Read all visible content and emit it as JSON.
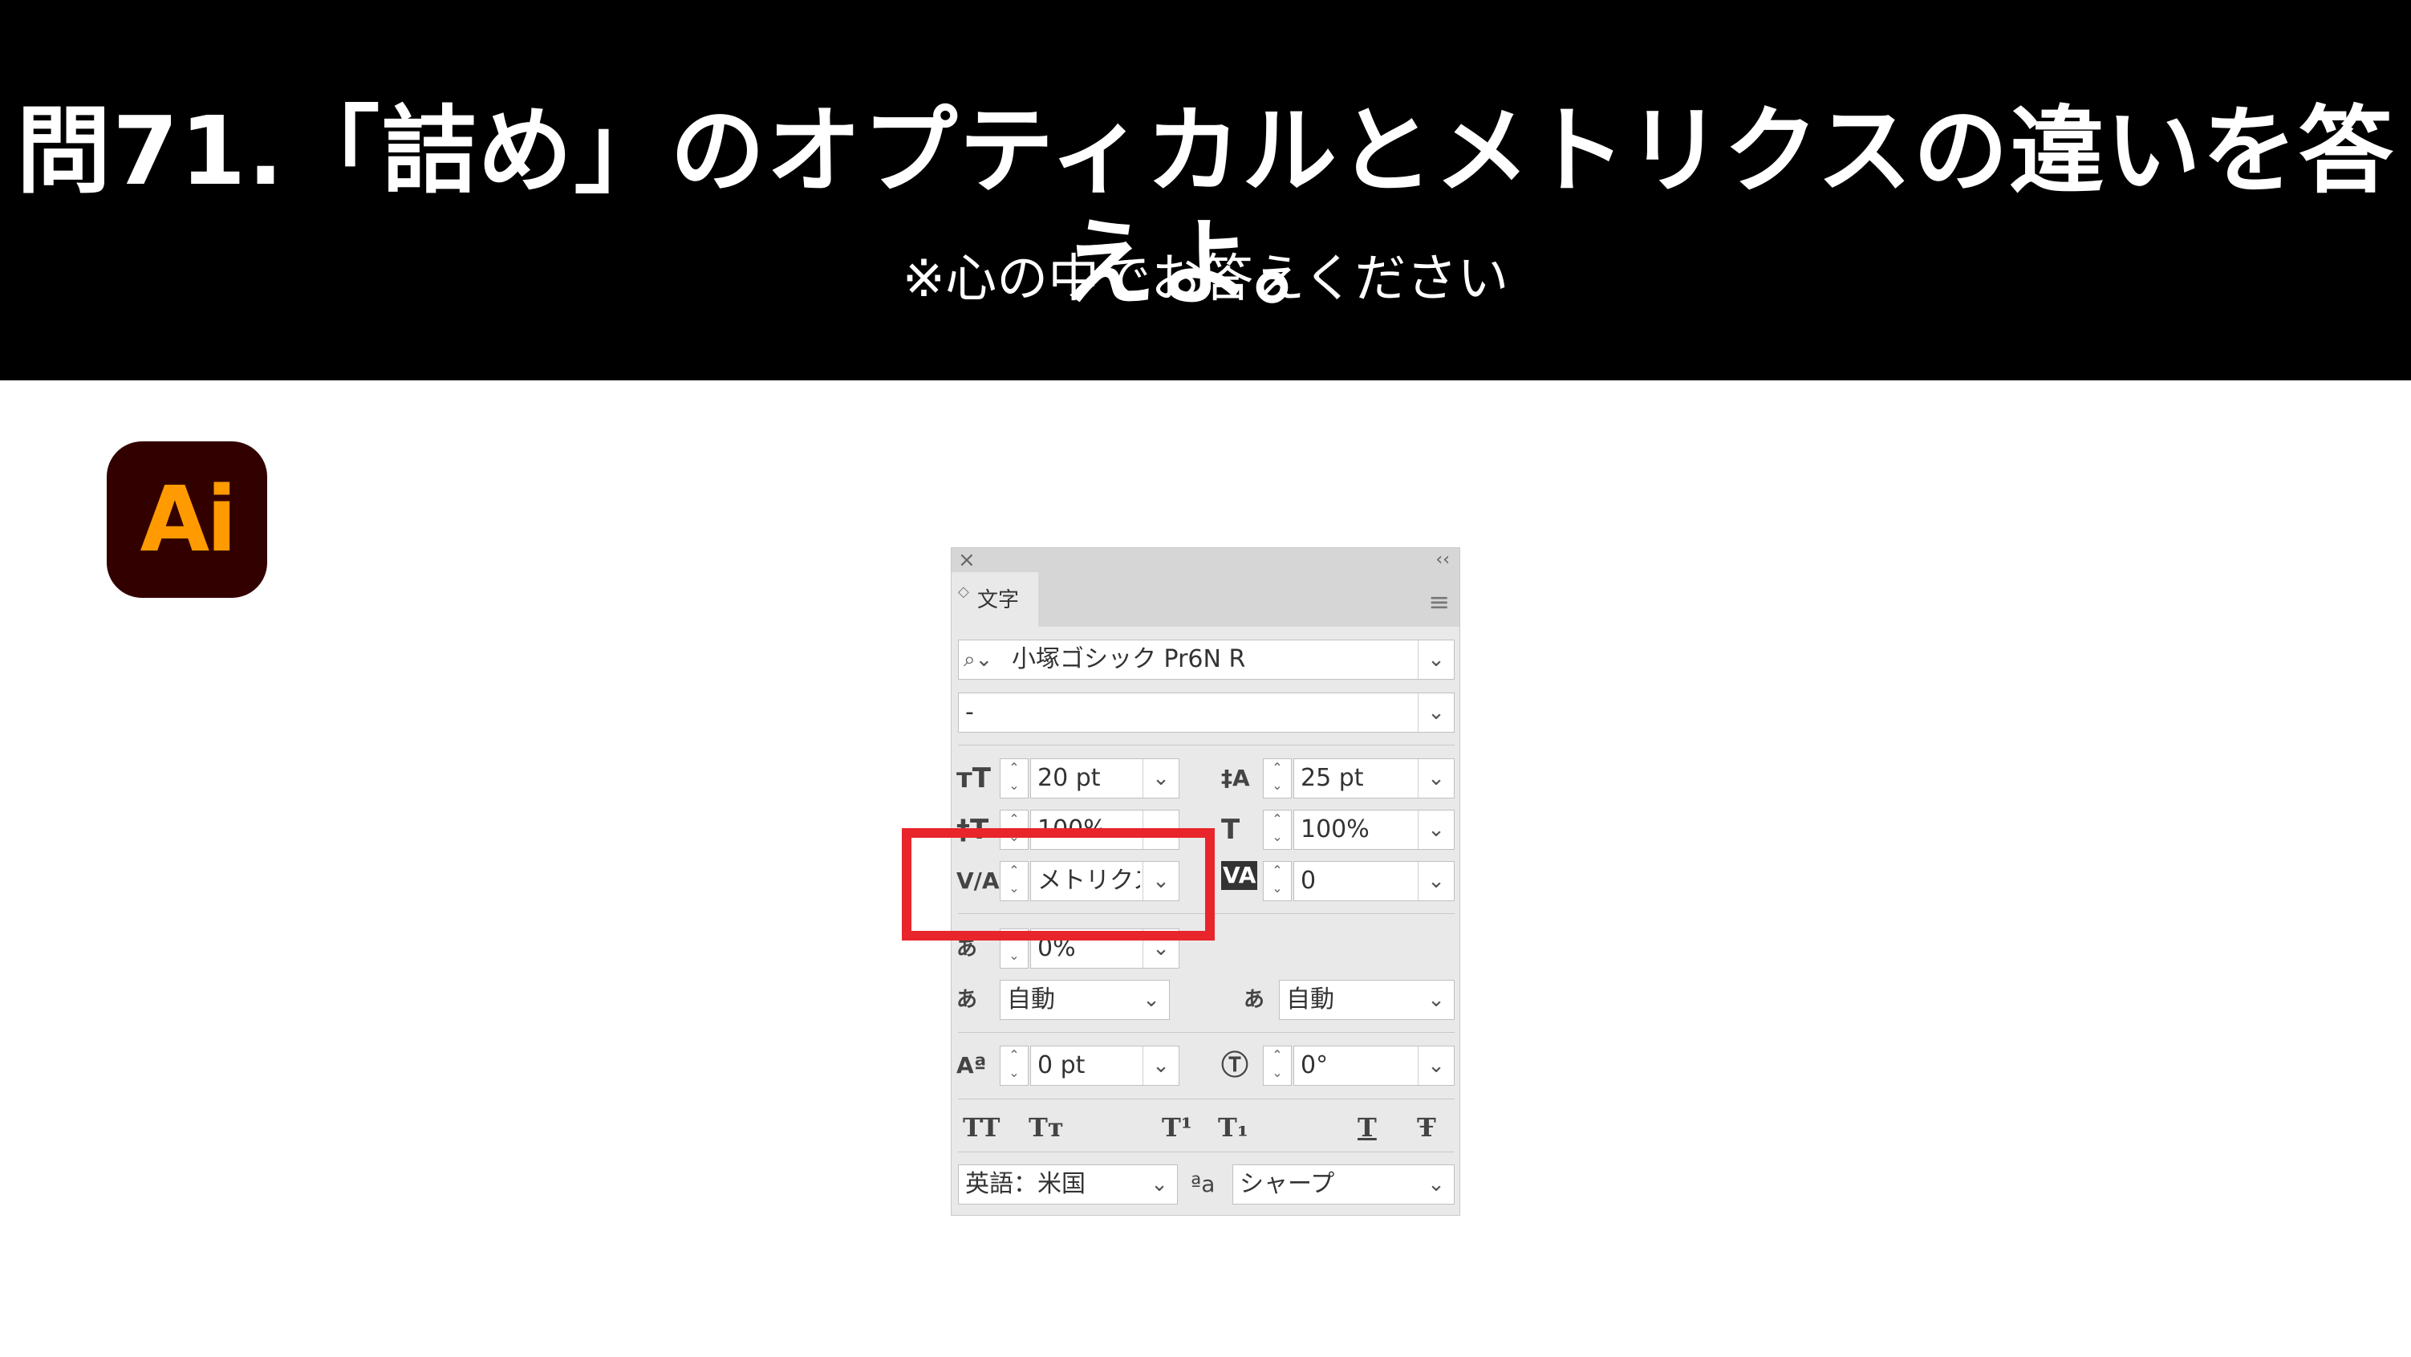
{
  "header": {
    "title": "問71.「詰め」のオプティカルとメトリクスの違いを答えよ。",
    "subtitle": "※心の中でお答えください"
  },
  "logo": {
    "text": "Ai",
    "bg_color": "#330000",
    "fg_color": "#ff9a00"
  },
  "panel": {
    "close_icon": "×",
    "collapse_icon": "‹‹",
    "tab_arrows": "◇",
    "tab_label": "文字",
    "menu_icon": "≡",
    "font_family": "小塚ゴシック Pr6N R",
    "font_style": "-",
    "font_size": "20 pt",
    "leading": "25 pt",
    "vertical_scale": "100%",
    "horizontal_scale": "100%",
    "kerning": "メトリクス",
    "tracking": "0",
    "tsume": "0%",
    "aki_left": "自動",
    "aki_right": "自動",
    "baseline_shift": "0 pt",
    "rotation": "0°",
    "language": "英語：米国",
    "antialias": "シャープ",
    "style_buttons": [
      "TT",
      "Tт",
      "T¹",
      "T₁",
      "T",
      "Ŧ"
    ]
  },
  "highlight_color": "#e8252b"
}
